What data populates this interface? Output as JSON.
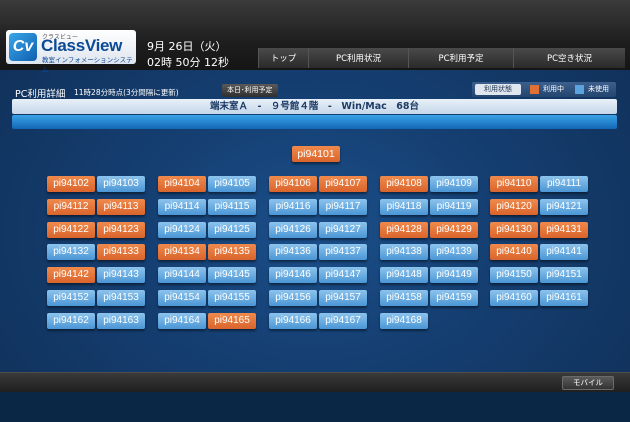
{
  "app": {
    "logo_ruby": "クラスビュー",
    "logo_name": "ClassView",
    "logo_sub": "教室インフォメーションシステム",
    "logo_mark": "Cv"
  },
  "header": {
    "date": "9月 26日（火）",
    "time": "02時 50分 12秒"
  },
  "nav": [
    "トップ",
    "PC利用状況",
    "PC利用予定",
    "PC空き状況"
  ],
  "subheader": {
    "title": "PC利用詳細",
    "update": "11時28分時点(3分間隔に更新)",
    "today_button": "本日･利用予定"
  },
  "legend": {
    "status_label": "利用状態",
    "in_use_label": "利用中",
    "unused_label": "未使用",
    "in_use_color": "#e07033",
    "unused_color": "#5aa3dd"
  },
  "room": {
    "banner": "端末室Ａ　-　９号館４階　-　Win/Mac　68台"
  },
  "single_pc": {
    "id": "pi94101",
    "status": "used"
  },
  "pc_groups": [
    {
      "pcs": [
        {
          "id": "pi94102",
          "status": "used"
        },
        {
          "id": "pi94103",
          "status": "unused"
        },
        {
          "id": "pi94112",
          "status": "used"
        },
        {
          "id": "pi94113",
          "status": "used"
        },
        {
          "id": "pi94122",
          "status": "used"
        },
        {
          "id": "pi94123",
          "status": "used"
        },
        {
          "id": "pi94132",
          "status": "unused"
        },
        {
          "id": "pi94133",
          "status": "used"
        },
        {
          "id": "pi94142",
          "status": "used"
        },
        {
          "id": "pi94143",
          "status": "unused"
        },
        {
          "id": "pi94152",
          "status": "unused"
        },
        {
          "id": "pi94153",
          "status": "unused"
        },
        {
          "id": "pi94162",
          "status": "unused"
        },
        {
          "id": "pi94163",
          "status": "unused"
        }
      ]
    },
    {
      "pcs": [
        {
          "id": "pi94104",
          "status": "used"
        },
        {
          "id": "pi94105",
          "status": "unused"
        },
        {
          "id": "pi94114",
          "status": "unused"
        },
        {
          "id": "pi94115",
          "status": "unused"
        },
        {
          "id": "pi94124",
          "status": "unused"
        },
        {
          "id": "pi94125",
          "status": "unused"
        },
        {
          "id": "pi94134",
          "status": "used"
        },
        {
          "id": "pi94135",
          "status": "used"
        },
        {
          "id": "pi94144",
          "status": "unused"
        },
        {
          "id": "pi94145",
          "status": "unused"
        },
        {
          "id": "pi94154",
          "status": "unused"
        },
        {
          "id": "pi94155",
          "status": "unused"
        },
        {
          "id": "pi94164",
          "status": "unused"
        },
        {
          "id": "pi94165",
          "status": "used"
        }
      ]
    },
    {
      "pcs": [
        {
          "id": "pi94106",
          "status": "used"
        },
        {
          "id": "pi94107",
          "status": "used"
        },
        {
          "id": "pi94116",
          "status": "unused"
        },
        {
          "id": "pi94117",
          "status": "unused"
        },
        {
          "id": "pi94126",
          "status": "unused"
        },
        {
          "id": "pi94127",
          "status": "unused"
        },
        {
          "id": "pi94136",
          "status": "unused"
        },
        {
          "id": "pi94137",
          "status": "unused"
        },
        {
          "id": "pi94146",
          "status": "unused"
        },
        {
          "id": "pi94147",
          "status": "unused"
        },
        {
          "id": "pi94156",
          "status": "unused"
        },
        {
          "id": "pi94157",
          "status": "unused"
        },
        {
          "id": "pi94166",
          "status": "unused"
        },
        {
          "id": "pi94167",
          "status": "unused"
        }
      ]
    },
    {
      "pcs": [
        {
          "id": "pi94108",
          "status": "used"
        },
        {
          "id": "pi94109",
          "status": "unused"
        },
        {
          "id": "pi94118",
          "status": "unused"
        },
        {
          "id": "pi94119",
          "status": "unused"
        },
        {
          "id": "pi94128",
          "status": "used"
        },
        {
          "id": "pi94129",
          "status": "used"
        },
        {
          "id": "pi94138",
          "status": "unused"
        },
        {
          "id": "pi94139",
          "status": "unused"
        },
        {
          "id": "pi94148",
          "status": "unused"
        },
        {
          "id": "pi94149",
          "status": "unused"
        },
        {
          "id": "pi94158",
          "status": "unused"
        },
        {
          "id": "pi94159",
          "status": "unused"
        },
        {
          "id": "pi94168",
          "status": "unused"
        }
      ]
    },
    {
      "pcs": [
        {
          "id": "pi94110",
          "status": "used"
        },
        {
          "id": "pi94111",
          "status": "unused"
        },
        {
          "id": "pi94120",
          "status": "used"
        },
        {
          "id": "pi94121",
          "status": "unused"
        },
        {
          "id": "pi94130",
          "status": "used"
        },
        {
          "id": "pi94131",
          "status": "used"
        },
        {
          "id": "pi94140",
          "status": "used"
        },
        {
          "id": "pi94141",
          "status": "unused"
        },
        {
          "id": "pi94150",
          "status": "unused"
        },
        {
          "id": "pi94151",
          "status": "unused"
        },
        {
          "id": "pi94160",
          "status": "unused"
        },
        {
          "id": "pi94161",
          "status": "unused"
        }
      ]
    }
  ],
  "footer": {
    "mobile_button": "モバイル"
  }
}
